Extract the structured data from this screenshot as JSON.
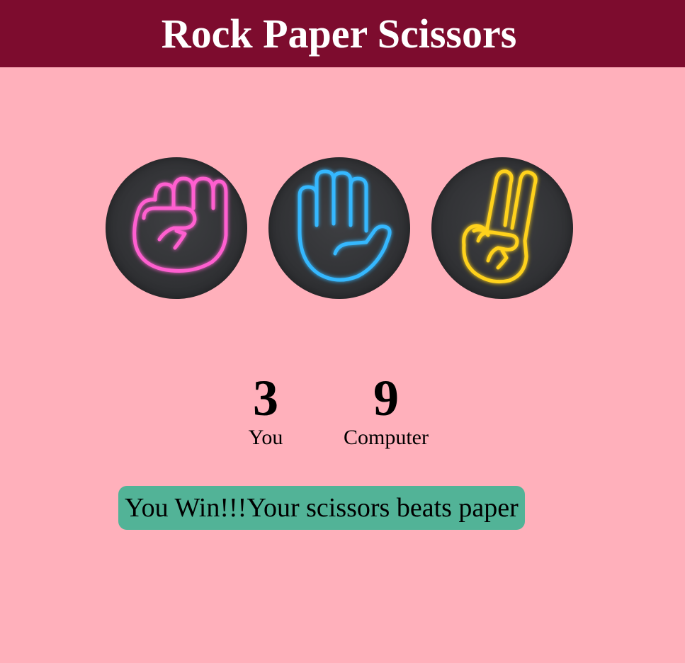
{
  "header": {
    "title": "Rock Paper Scissors",
    "background": "#7d0c2e"
  },
  "page": {
    "background": "#ffb0bb"
  },
  "choices": [
    {
      "id": "rock",
      "icon": "neon-fist-icon",
      "color": "#ff5fd0"
    },
    {
      "id": "paper",
      "icon": "neon-open-hand-icon",
      "color": "#35b8ff"
    },
    {
      "id": "scissors",
      "icon": "neon-peace-hand-icon",
      "color": "#ffd21c"
    }
  ],
  "scoreboard": {
    "user": {
      "score": "3",
      "label": "You"
    },
    "computer": {
      "score": "9",
      "label": "Computer"
    }
  },
  "message": {
    "text": "You Win!!!Your scissors beats paper",
    "background": "#52b397"
  }
}
